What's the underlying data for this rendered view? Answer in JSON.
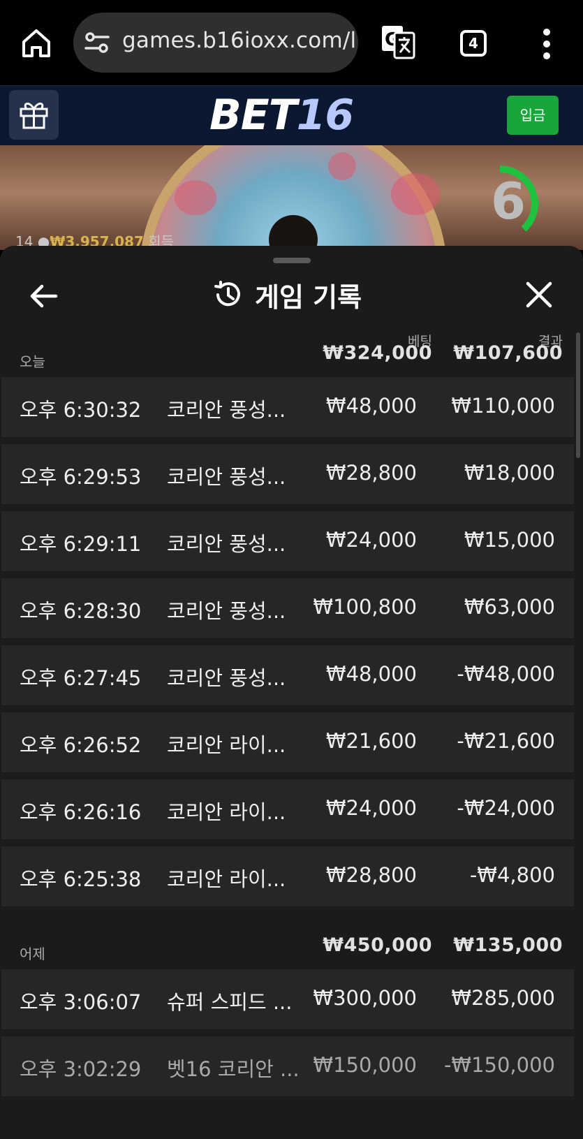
{
  "browser": {
    "url": "games.b16ioxx.com/l",
    "tab_count": "4"
  },
  "header": {
    "logo_bet": "BET",
    "logo_num": "16",
    "deposit_label": "입금"
  },
  "video": {
    "stats_prefix": "14 ●",
    "stats_amount": "₩3,957,087",
    "stats_suffix": "회득",
    "countdown": "6"
  },
  "sheet": {
    "title": "게임 기록",
    "col_bet": "베팅",
    "col_result": "결과",
    "groups": [
      {
        "label": "오늘",
        "bet_total": "₩324,000",
        "result_total": "₩107,600",
        "rows": [
          {
            "time": "오후 6:30:32",
            "game": "코리안 풍성...",
            "bet": "₩48,000",
            "result": "₩110,000"
          },
          {
            "time": "오후 6:29:53",
            "game": "코리안 풍성...",
            "bet": "₩28,800",
            "result": "₩18,000"
          },
          {
            "time": "오후 6:29:11",
            "game": "코리안 풍성...",
            "bet": "₩24,000",
            "result": "₩15,000"
          },
          {
            "time": "오후 6:28:30",
            "game": "코리안 풍성...",
            "bet": "₩100,800",
            "result": "₩63,000"
          },
          {
            "time": "오후 6:27:45",
            "game": "코리안 풍성...",
            "bet": "₩48,000",
            "result": "-₩48,000"
          },
          {
            "time": "오후 6:26:52",
            "game": "코리안 라이...",
            "bet": "₩21,600",
            "result": "-₩21,600"
          },
          {
            "time": "오후 6:26:16",
            "game": "코리안 라이...",
            "bet": "₩24,000",
            "result": "-₩24,000"
          },
          {
            "time": "오후 6:25:38",
            "game": "코리안 라이...",
            "bet": "₩28,800",
            "result": "-₩4,800"
          }
        ]
      },
      {
        "label": "어제",
        "bet_total": "₩450,000",
        "result_total": "₩135,000",
        "rows": [
          {
            "time": "오후 3:06:07",
            "game": "슈퍼 스피드 ...",
            "bet": "₩300,000",
            "result": "₩285,000"
          },
          {
            "time": "오후 3:02:29",
            "game": "벳16 코리안 ...",
            "bet": "₩150,000",
            "result": "-₩150,000"
          }
        ]
      }
    ]
  },
  "colors": {
    "header_bg": "#0b1831",
    "deposit_green": "#1aa53a",
    "sheet_bg": "#1b1b1b",
    "row_bg": "#262626",
    "timer_green": "#1fc23f"
  }
}
